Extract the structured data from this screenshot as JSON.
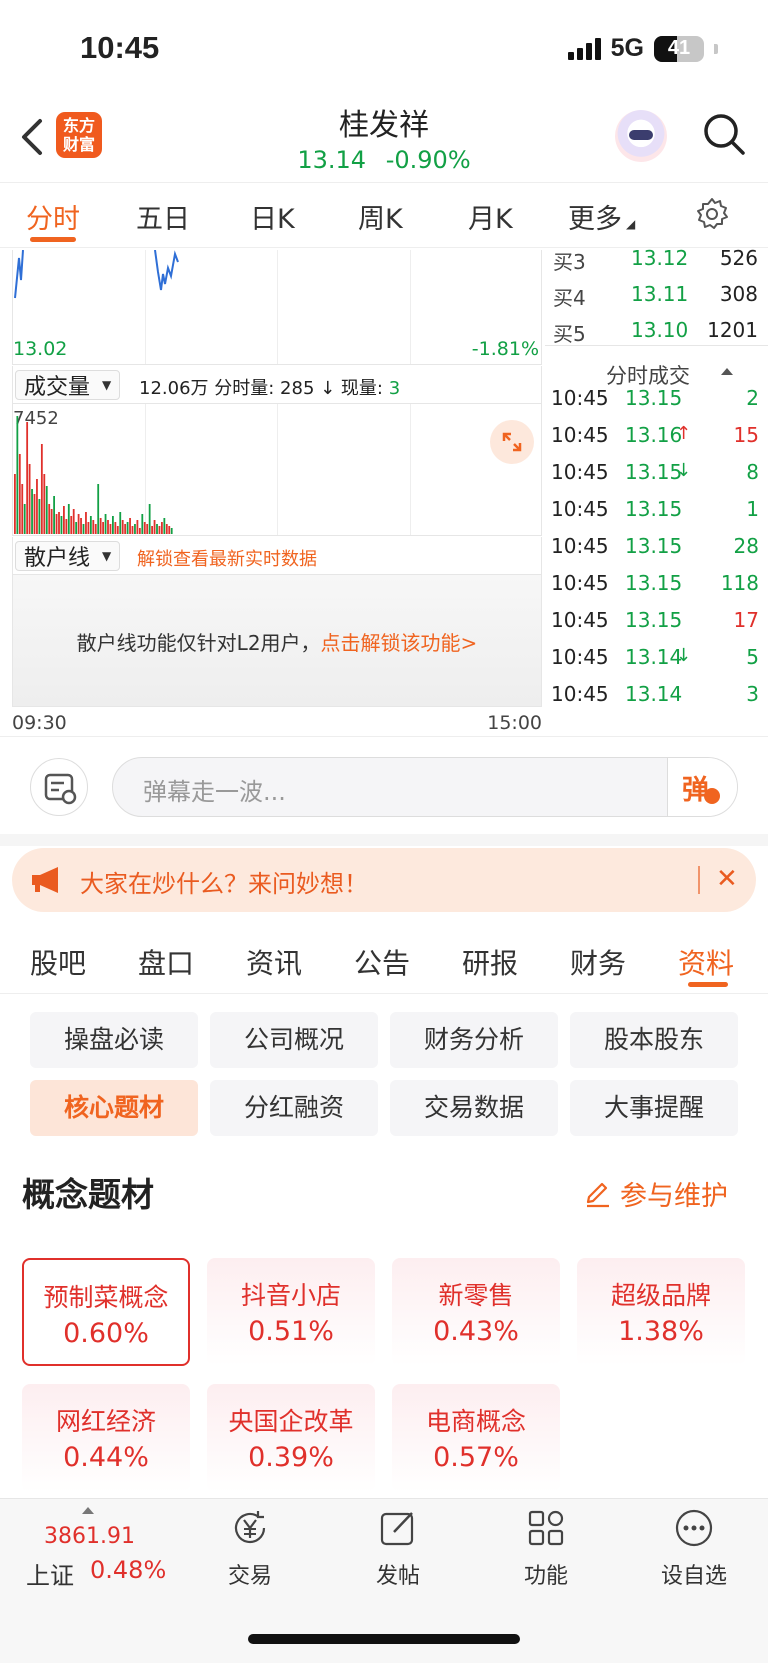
{
  "status": {
    "time": "10:45",
    "network": "5G",
    "battery": "41"
  },
  "header": {
    "logo_line1": "东方",
    "logo_line2": "财富",
    "name": "桂发祥",
    "price": "13.14",
    "change_pct": "-0.90%"
  },
  "chart_tabs": [
    "分时",
    "五日",
    "日K",
    "周K",
    "月K",
    "更多"
  ],
  "chart": {
    "low_price": "13.02",
    "low_pct": "-1.81%",
    "volume_selector": "成交量",
    "volume_info_main": "12.06万 分时量: 285 ↓ 现量:",
    "volume_info_now": "3",
    "volume_max": "7452",
    "scatter_selector": "散户线",
    "scatter_unlock": "解锁查看最新实时数据",
    "locked_msg": "散户线功能仅针对L2用户，",
    "locked_link": "点击解锁该功能>",
    "time_start": "09:30",
    "time_end": "15:00"
  },
  "order_book": [
    {
      "label": "买3",
      "price": "13.12",
      "volume": "526"
    },
    {
      "label": "买4",
      "price": "13.11",
      "volume": "308"
    },
    {
      "label": "买5",
      "price": "13.10",
      "volume": "1201"
    }
  ],
  "ticks_title": "分时成交",
  "ticks": [
    {
      "time": "10:45",
      "price": "13.15",
      "arrow": "",
      "volume": "2",
      "color": "green"
    },
    {
      "time": "10:45",
      "price": "13.16",
      "arrow": "↑",
      "volume": "15",
      "color": "red"
    },
    {
      "time": "10:45",
      "price": "13.15",
      "arrow": "↓",
      "volume": "8",
      "color": "green"
    },
    {
      "time": "10:45",
      "price": "13.15",
      "arrow": "",
      "volume": "1",
      "color": "green"
    },
    {
      "time": "10:45",
      "price": "13.15",
      "arrow": "",
      "volume": "28",
      "color": "green"
    },
    {
      "time": "10:45",
      "price": "13.15",
      "arrow": "",
      "volume": "118",
      "color": "green"
    },
    {
      "time": "10:45",
      "price": "13.15",
      "arrow": "",
      "volume": "17",
      "color": "red"
    },
    {
      "time": "10:45",
      "price": "13.14",
      "arrow": "↓",
      "volume": "5",
      "color": "green"
    },
    {
      "time": "10:45",
      "price": "13.14",
      "arrow": "",
      "volume": "3",
      "color": "green"
    }
  ],
  "comment": {
    "placeholder": "弹幕走一波...",
    "send_label": "弹"
  },
  "banner": {
    "text": "大家在炒什么？来问妙想！",
    "close": "✕"
  },
  "section_tabs": [
    "股吧",
    "盘口",
    "资讯",
    "公告",
    "研报",
    "财务",
    "资料"
  ],
  "grid_buttons": [
    "操盘必读",
    "公司概况",
    "财务分析",
    "股本股东",
    "核心题材",
    "分红融资",
    "交易数据",
    "大事提醒"
  ],
  "concept": {
    "title": "概念题材",
    "maintain": "参与维护",
    "cards": [
      {
        "name": "预制菜概念",
        "pct": "0.60%"
      },
      {
        "name": "抖音小店",
        "pct": "0.51%"
      },
      {
        "name": "新零售",
        "pct": "0.43%"
      },
      {
        "name": "超级品牌",
        "pct": "1.38%"
      },
      {
        "name": "网红经济",
        "pct": "0.44%"
      },
      {
        "name": "央国企改革",
        "pct": "0.39%"
      },
      {
        "name": "电商概念",
        "pct": "0.57%"
      }
    ]
  },
  "bottom": {
    "index_value": "3861.91",
    "index_name": "上证",
    "index_pct": "0.48%",
    "nav": [
      "交易",
      "发帖",
      "功能",
      "设自选"
    ]
  },
  "colors": {
    "accent": "#f06420",
    "up": "#e0302b",
    "down": "#12a045"
  }
}
